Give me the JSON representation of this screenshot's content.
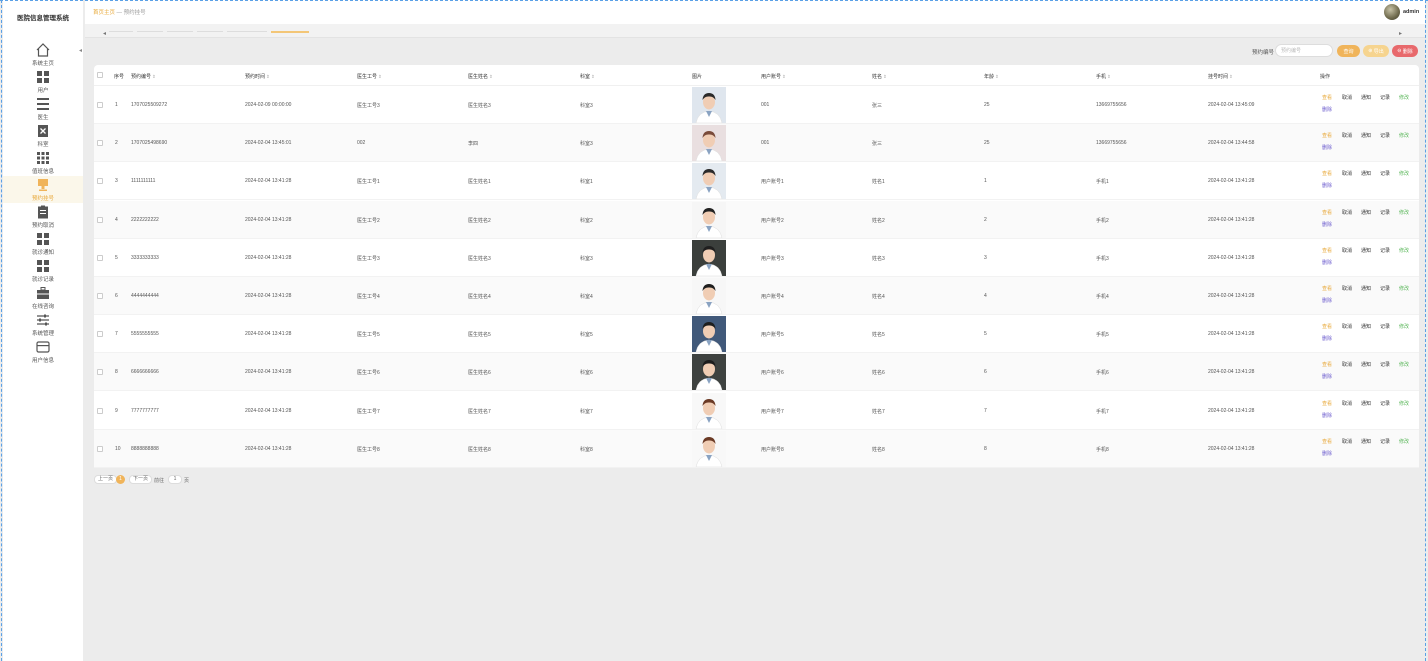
{
  "app": {
    "title": "医院信息管理系统"
  },
  "sidebar": {
    "items": [
      {
        "label": "系统主页",
        "icon": "home-icon"
      },
      {
        "label": "用户",
        "icon": "grid-icon"
      },
      {
        "label": "医生",
        "icon": "list-icon"
      },
      {
        "label": "科室",
        "icon": "delete-box-icon"
      },
      {
        "label": "值班信息",
        "icon": "apps-icon"
      },
      {
        "label": "预约挂号",
        "icon": "stamp-icon"
      },
      {
        "label": "预约取消",
        "icon": "clipboard-icon"
      },
      {
        "label": "就诊通知",
        "icon": "grid-icon"
      },
      {
        "label": "就诊记录",
        "icon": "grid-icon"
      },
      {
        "label": "在线咨询",
        "icon": "briefcase-icon"
      },
      {
        "label": "系统管理",
        "icon": "sliders-icon"
      },
      {
        "label": "用户信息",
        "icon": "card-icon"
      }
    ],
    "active_index": 5
  },
  "header": {
    "breadcrumb": {
      "home": "首页主页",
      "separator": "—",
      "current": "预约挂号"
    },
    "user": "admin"
  },
  "search": {
    "label": "预约编号",
    "placeholder": "预约编号",
    "search_btn": "查询",
    "export_btn": "导出",
    "delete_btn": "删除"
  },
  "table": {
    "headers": {
      "index": "序号",
      "appt_no": "预约编号",
      "appt_time": "预约时间",
      "doctor_no": "医生工号",
      "doctor_name": "医生姓名",
      "dept": "科室",
      "photo": "图片",
      "user_no": "用户账号",
      "name": "姓名",
      "age": "年龄",
      "phone": "手机",
      "reg_time": "挂号时间",
      "ops": "操作"
    },
    "sort_mark": "⇕",
    "ops": {
      "view": "查看",
      "cancel": "取消",
      "notify": "通知",
      "record": "记录",
      "edit": "修改",
      "delete": "删除"
    },
    "rows": [
      {
        "index": "1",
        "appt_no": "1707025509272",
        "appt_time": "2024-02-09 00:00:00",
        "doctor_no": "医生工号3",
        "doctor_name": "医生姓名3",
        "dept": "科室3",
        "user_no": "001",
        "name": "张三",
        "age": "25",
        "phone": "13669755656",
        "reg_time": "2024-02-04 13:45:09"
      },
      {
        "index": "2",
        "appt_no": "1707025498690",
        "appt_time": "2024-02-04 13:45:01",
        "doctor_no": "002",
        "doctor_name": "李四",
        "dept": "科室3",
        "user_no": "001",
        "name": "张三",
        "age": "25",
        "phone": "13669755656",
        "reg_time": "2024-02-04 13:44:58"
      },
      {
        "index": "3",
        "appt_no": "1111111111",
        "appt_time": "2024-02-04 13:41:28",
        "doctor_no": "医生工号1",
        "doctor_name": "医生姓名1",
        "dept": "科室1",
        "user_no": "用户账号1",
        "name": "姓名1",
        "age": "1",
        "phone": "手机1",
        "reg_time": "2024-02-04 13:41:28"
      },
      {
        "index": "4",
        "appt_no": "2222222222",
        "appt_time": "2024-02-04 13:41:28",
        "doctor_no": "医生工号2",
        "doctor_name": "医生姓名2",
        "dept": "科室2",
        "user_no": "用户账号2",
        "name": "姓名2",
        "age": "2",
        "phone": "手机2",
        "reg_time": "2024-02-04 13:41:28"
      },
      {
        "index": "5",
        "appt_no": "3333333333",
        "appt_time": "2024-02-04 13:41:28",
        "doctor_no": "医生工号3",
        "doctor_name": "医生姓名3",
        "dept": "科室3",
        "user_no": "用户账号3",
        "name": "姓名3",
        "age": "3",
        "phone": "手机3",
        "reg_time": "2024-02-04 13:41:28"
      },
      {
        "index": "6",
        "appt_no": "4444444444",
        "appt_time": "2024-02-04 13:41:28",
        "doctor_no": "医生工号4",
        "doctor_name": "医生姓名4",
        "dept": "科室4",
        "user_no": "用户账号4",
        "name": "姓名4",
        "age": "4",
        "phone": "手机4",
        "reg_time": "2024-02-04 13:41:28"
      },
      {
        "index": "7",
        "appt_no": "5555555555",
        "appt_time": "2024-02-04 13:41:28",
        "doctor_no": "医生工号5",
        "doctor_name": "医生姓名5",
        "dept": "科室5",
        "user_no": "用户账号5",
        "name": "姓名5",
        "age": "5",
        "phone": "手机5",
        "reg_time": "2024-02-04 13:41:28"
      },
      {
        "index": "8",
        "appt_no": "6666666666",
        "appt_time": "2024-02-04 13:41:28",
        "doctor_no": "医生工号6",
        "doctor_name": "医生姓名6",
        "dept": "科室6",
        "user_no": "用户账号6",
        "name": "姓名6",
        "age": "6",
        "phone": "手机6",
        "reg_time": "2024-02-04 13:41:28"
      },
      {
        "index": "9",
        "appt_no": "7777777777",
        "appt_time": "2024-02-04 13:41:28",
        "doctor_no": "医生工号7",
        "doctor_name": "医生姓名7",
        "dept": "科室7",
        "user_no": "用户账号7",
        "name": "姓名7",
        "age": "7",
        "phone": "手机7",
        "reg_time": "2024-02-04 13:41:28"
      },
      {
        "index": "10",
        "appt_no": "8888888888",
        "appt_time": "2024-02-04 13:41:28",
        "doctor_no": "医生工号8",
        "doctor_name": "医生姓名8",
        "dept": "科室8",
        "user_no": "用户账号8",
        "name": "姓名8",
        "age": "8",
        "phone": "手机8",
        "reg_time": "2024-02-04 13:41:28"
      }
    ]
  },
  "pagination": {
    "prev": "上一页",
    "current": "1",
    "next": "下一页",
    "goto_prefix": "前往",
    "goto_value": "1",
    "goto_suffix": "页"
  },
  "colors": {
    "accent": "#f0b45a",
    "danger": "#e8696c",
    "edit": "#5cb85c",
    "delete": "#6a5acd"
  }
}
